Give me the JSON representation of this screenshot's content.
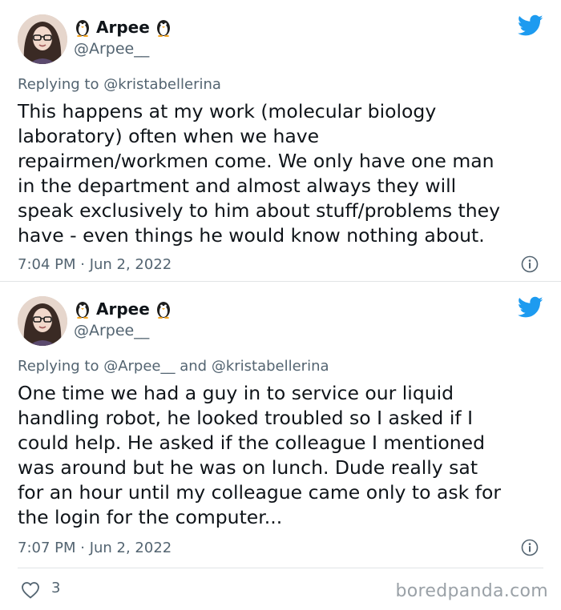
{
  "tweets": [
    {
      "display_name": "Arpee",
      "handle": "@Arpee__",
      "reply_prefix": "Replying to",
      "reply_mentions": "@kristabellerina",
      "body_lines": [
        "This happens at my work (molecular biology",
        "laboratory) often when we have",
        "repairmen/workmen come. We only have one man",
        "in the department and almost always they will",
        "speak exclusively to him about stuff/problems they",
        "have - even things he would know nothing about."
      ],
      "timestamp": "7:04 PM · Jun 2, 2022"
    },
    {
      "display_name": "Arpee",
      "handle": "@Arpee__",
      "reply_prefix": "Replying to",
      "reply_mentions": "@Arpee__ and @kristabellerina",
      "body_lines": [
        "One time we had a guy in to service our liquid",
        "handling robot, he looked troubled so I asked if I",
        "could help. He asked if the colleague I mentioned",
        "was around but he was on lunch. Dude really sat",
        "for an hour until my colleague came only to ask for",
        "the login for the computer..."
      ],
      "timestamp": "7:07 PM · Jun 2, 2022"
    }
  ],
  "like_count": "3",
  "watermark": "boredpanda.com",
  "colors": {
    "twitter_blue": "#1d9bf0",
    "muted_text": "#536471",
    "body_text": "#0f1419"
  },
  "icons": {
    "brand": "twitter-bird-icon",
    "info": "info-icon",
    "like": "heart-icon",
    "emoji": "penguin-icon"
  }
}
